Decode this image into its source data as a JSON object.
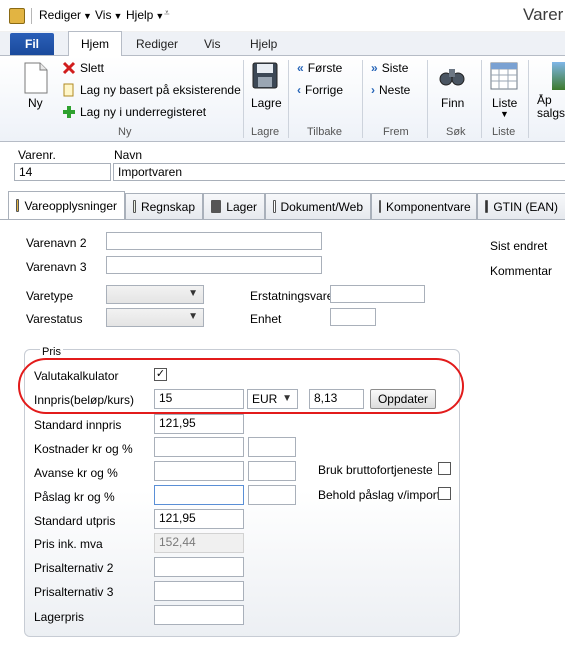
{
  "titlebar": {
    "menu_rediger": "Rediger",
    "menu_vis": "Vis",
    "menu_hjelp": "Hjelp",
    "app_title": "Varer"
  },
  "ribbon_tabs": [
    "Fil",
    "Hjem",
    "Rediger",
    "Vis",
    "Hjelp"
  ],
  "ribbon": {
    "ny": "Ny",
    "slett": "Slett",
    "lag_ny_basert": "Lag ny basert på eksisterende",
    "lag_ny_under": "Lag ny i underregisteret",
    "lagre": "Lagre",
    "forste": "Første",
    "forrige": "Forrige",
    "siste": "Siste",
    "neste": "Neste",
    "finn": "Finn",
    "liste": "Liste",
    "apne_salgsa": "Åp salgsa",
    "groups": {
      "ny": "Ny",
      "lagre": "Lagre",
      "tilbake": "Tilbake",
      "frem": "Frem",
      "sok": "Søk",
      "liste": "Liste"
    }
  },
  "header": {
    "varenr_label": "Varenr.",
    "navn_label": "Navn",
    "varenr_value": "14",
    "navn_value": "Importvaren"
  },
  "content_tabs": [
    "Vareopplysninger",
    "Regnskap",
    "Lager",
    "Dokument/Web",
    "Komponentvare",
    "GTIN (EAN)"
  ],
  "form": {
    "varenavn2": "Varenavn 2",
    "varenavn3": "Varenavn 3",
    "varetype": "Varetype",
    "varestatus": "Varestatus",
    "erstatningsvare": "Erstatningsvare",
    "enhet": "Enhet",
    "sist_endret": "Sist endret",
    "kommentar": "Kommentar"
  },
  "pris": {
    "group_title": "Pris",
    "valutakalkulator": "Valutakalkulator",
    "valutakalkulator_checked": true,
    "innpris_label": "Innpris(beløp/kurs)",
    "innpris_value": "15",
    "currency": "EUR",
    "kurs_value": "8,13",
    "oppdater": "Oppdater",
    "standard_innpris_label": "Standard innpris",
    "standard_innpris_value": "121,95",
    "kostnader_label": "Kostnader kr og  %",
    "avanse_label": "Avanse kr og %",
    "paslag_label": "Påslag kr og %",
    "standard_utpris_label": "Standard utpris",
    "standard_utpris_value": "121,95",
    "pris_ink_mva_label": "Pris ink. mva",
    "pris_ink_mva_value": "152,44",
    "prisalternativ2_label": "Prisalternativ 2",
    "prisalternativ3_label": "Prisalternativ 3",
    "lagerpris_label": "Lagerpris",
    "bruk_bruttofortjeneste": "Bruk bruttofortjeneste",
    "behold_paslag": "Behold påslag v/import"
  },
  "colors": {
    "accent_blue": "#2b5fb8",
    "highlight_red": "#e21b1b"
  }
}
